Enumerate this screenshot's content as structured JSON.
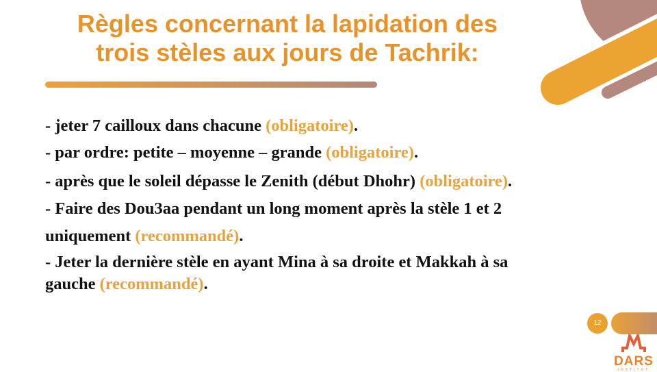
{
  "slide": {
    "title_lines": [
      "Règles concernant la lapidation des",
      "trois stèles aux jours de Tachrik:"
    ],
    "bullets": [
      {
        "text": "- jeter 7 cailloux dans chacune ",
        "tag": "(obligatoire)",
        "end": "."
      },
      {
        "text": "- par ordre: petite – moyenne – grande ",
        "tag": "(obligatoire)",
        "end": "."
      },
      {
        "text": "- après que le soleil dépasse le Zenith (début Dhohr) ",
        "tag": "(obligatoire)",
        "end": "."
      },
      {
        "text": "- Faire des Dou3aa pendant un long moment après la stèle 1 et 2",
        "tag": "",
        "end": ""
      },
      {
        "text": "uniquement ",
        "tag": "(recommandé)",
        "end": "."
      },
      {
        "text": "- Jeter la dernière stèle en ayant Mina à sa droite et Makkah à sa",
        "tag": "",
        "end": ""
      },
      {
        "text": "gauche ",
        "tag": "(recommandé)",
        "end": "."
      }
    ],
    "page_number": "12",
    "logo": {
      "name": "DARS",
      "subtitle": "INSTITUT"
    }
  },
  "colors": {
    "accent": "#E8922A",
    "secondary": "#B4877A",
    "text": "#111111"
  }
}
